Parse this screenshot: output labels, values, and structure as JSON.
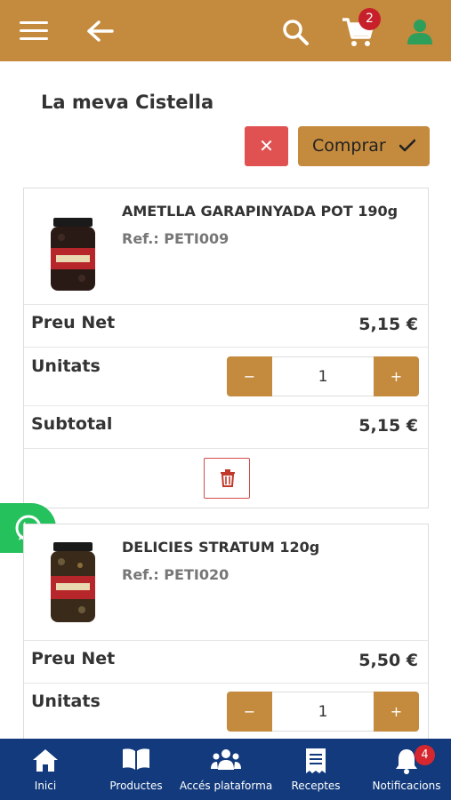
{
  "header": {
    "cart_count": "2",
    "colors": {
      "bar": "#c48a3d",
      "badge": "#c8202b",
      "user_icon": "#2e9e5b"
    }
  },
  "page": {
    "title": "La meva Cistella"
  },
  "actions": {
    "clear_icon": "✕",
    "buy_label": "Comprar"
  },
  "labels": {
    "price": "Preu Net",
    "units": "Unitats",
    "subtotal": "Subtotal",
    "minus": "−",
    "plus": "+"
  },
  "items": [
    {
      "name": "AMETLLA GARAPINYADA POT 190g",
      "ref": "Ref.: PETI009",
      "price": "5,15 €",
      "quantity": "1",
      "subtotal": "5,15 €"
    },
    {
      "name": "DELICIES STRATUM 120g",
      "ref": "Ref.: PETI020",
      "price": "5,50 €",
      "quantity": "1"
    }
  ],
  "bottom_nav": {
    "items": [
      {
        "label": "Inici",
        "icon": "home-icon"
      },
      {
        "label": "Productes",
        "icon": "book-icon"
      },
      {
        "label": "Accés plataforma",
        "icon": "users-icon"
      },
      {
        "label": "Receptes",
        "icon": "receipt-icon"
      },
      {
        "label": "Notificacions",
        "icon": "bell-icon"
      }
    ],
    "notification_count": "4"
  }
}
